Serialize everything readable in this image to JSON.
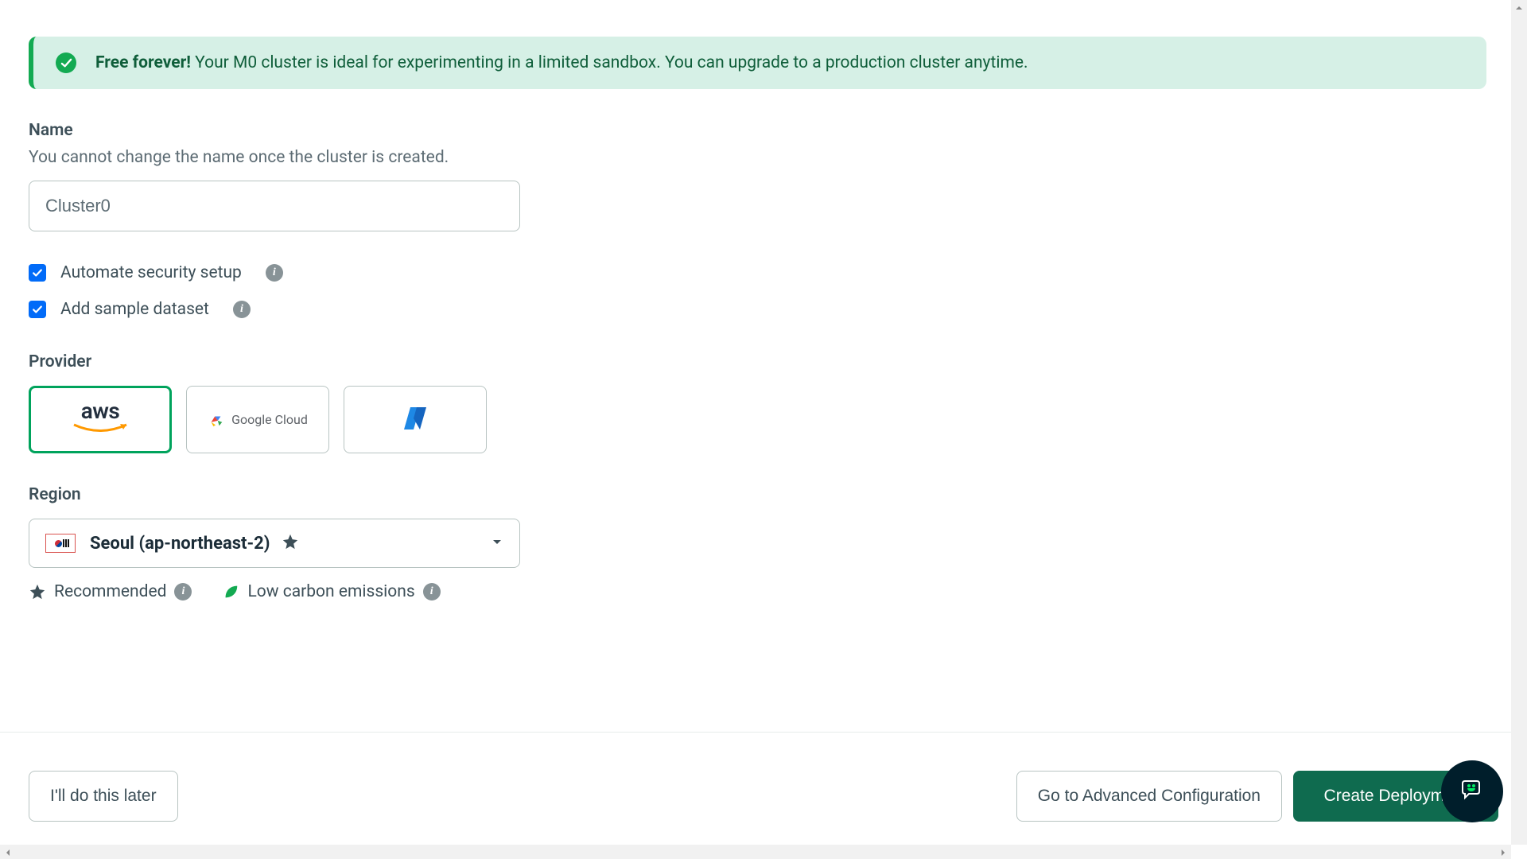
{
  "banner": {
    "strong": "Free forever!",
    "text": " Your M0 cluster is ideal for experimenting in a limited sandbox. You can upgrade to a production cluster anytime."
  },
  "name": {
    "label": "Name",
    "sub": "You cannot change the name once the cluster is created.",
    "value": "Cluster0"
  },
  "checkboxes": {
    "security": "Automate security setup",
    "sample": "Add sample dataset"
  },
  "provider": {
    "label": "Provider",
    "aws": "aws",
    "gcp": "Google Cloud"
  },
  "region": {
    "label": "Region",
    "value": "Seoul (ap-northeast-2)"
  },
  "legend": {
    "recommended": "Recommended",
    "low_carbon": "Low carbon emissions"
  },
  "footer": {
    "later": "I'll do this later",
    "advanced": "Go to Advanced Configuration",
    "create": "Create Deployment"
  }
}
